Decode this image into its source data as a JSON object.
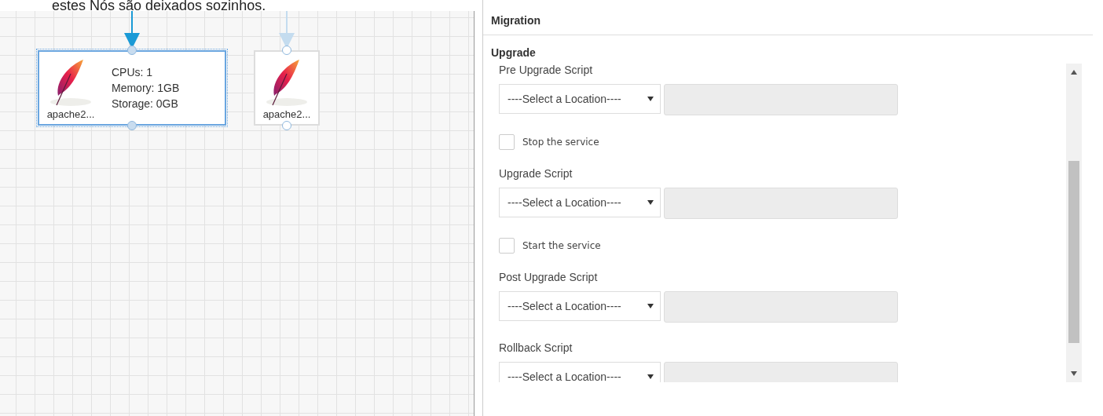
{
  "caption": "estes Nós são deixados sozinhos.",
  "canvas": {
    "nodes": [
      {
        "label": "apache2...",
        "selected": true,
        "details": [
          "CPUs: 1",
          "Memory: 1GB",
          "Storage: 0GB"
        ]
      },
      {
        "label": "apache2...",
        "selected": false
      }
    ]
  },
  "panel": {
    "title": "Migration",
    "section": "Upgrade",
    "fields": [
      {
        "kind": "script",
        "label": "Pre Upgrade Script",
        "select": "----Select a Location----"
      },
      {
        "kind": "checkbox",
        "label": "Stop the service",
        "checked": false
      },
      {
        "kind": "script",
        "label": "Upgrade Script",
        "select": "----Select a Location----"
      },
      {
        "kind": "checkbox",
        "label": "Start the service",
        "checked": false
      },
      {
        "kind": "script",
        "label": "Post Upgrade Script",
        "select": "----Select a Location----"
      },
      {
        "kind": "script",
        "label": "Rollback Script",
        "select": "----Select a Location----"
      }
    ]
  }
}
